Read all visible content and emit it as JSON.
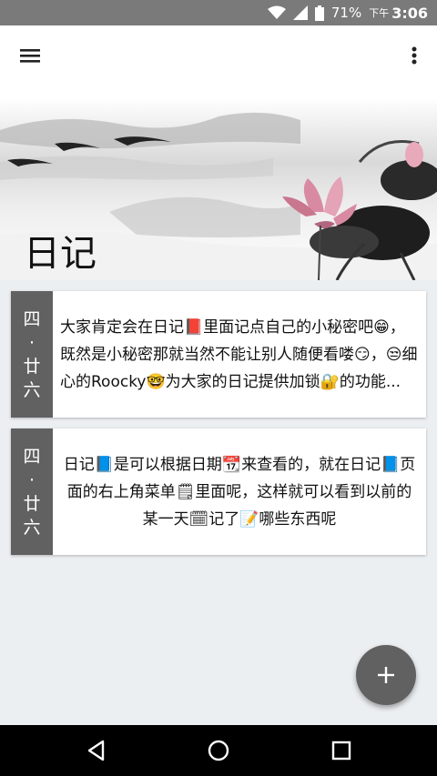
{
  "status_bar": {
    "battery": "71%",
    "ampm": "下午",
    "time": "3:06",
    "icons": [
      "wifi-icon",
      "signal-icon",
      "battery-icon"
    ]
  },
  "toolbar": {
    "menu_icon": "hamburger-menu-icon",
    "more_icon": "more-vert-icon"
  },
  "header": {
    "title": "日记"
  },
  "entries": [
    {
      "date_top": "四",
      "date_sep": "·",
      "date_bottom1": "廿",
      "date_bottom2": "六",
      "text": "大家肯定会在日记📕里面记点自己的小秘密吧😁，既然是小秘密那就当然不能让别人随便看喽😏，😒细心的Roocky🤓为大家的日记提供加锁🔐的功能..."
    },
    {
      "date_top": "四",
      "date_sep": "·",
      "date_bottom1": "廿",
      "date_bottom2": "六",
      "text": "日记📘是可以根据日期📆来查看的，就在日记📘页面的右上角菜单🗒里面呢，这样就可以看到以前的某一天🗓记了📝哪些东西呢"
    }
  ],
  "fab": {
    "icon": "add-icon"
  },
  "nav": {
    "back_icon": "back-icon",
    "home_icon": "home-icon",
    "recents_icon": "recents-icon"
  },
  "colors": {
    "status_bar": "#7a7a7a",
    "date_column": "#616161",
    "background": "#eceff1",
    "fab": "#616161",
    "lotus_pink": "#d98aa3"
  }
}
